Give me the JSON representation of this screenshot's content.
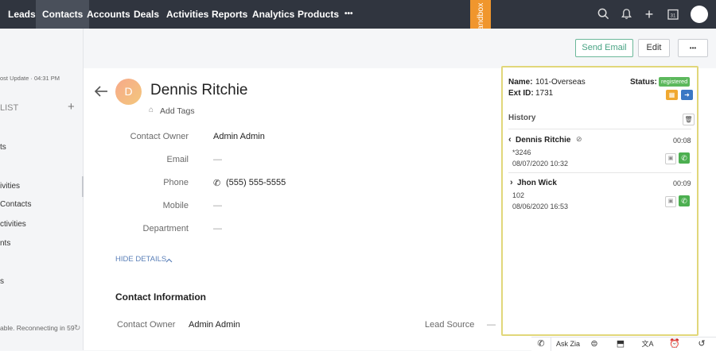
{
  "nav": {
    "items": [
      "Leads",
      "Contacts",
      "Accounts",
      "Deals",
      "Activities",
      "Reports",
      "Analytics",
      "Products"
    ],
    "more": "•••",
    "sandbox": "Sandbox"
  },
  "sidebar": {
    "last_update": "ost Update · 04:31 PM",
    "list_header": "LIST",
    "add": "+",
    "items": [
      "ts",
      "ivities",
      "Contacts",
      "ctivities",
      "nts",
      "s"
    ],
    "status": "able. Reconnecting in 59"
  },
  "toolbar": {
    "send_email": "Send Email",
    "edit": "Edit",
    "more": "•••"
  },
  "contact": {
    "avatar_letter": "D",
    "name": "Dennis Ritchie",
    "add_tags": "Add Tags",
    "fields": [
      {
        "label": "Contact Owner",
        "value": "Admin Admin"
      },
      {
        "label": "Email",
        "value": "—"
      },
      {
        "label": "Phone",
        "value": "(555) 555-5555"
      },
      {
        "label": "Mobile",
        "value": "—"
      },
      {
        "label": "Department",
        "value": "—"
      }
    ],
    "hide_details": "HIDE DETAILS"
  },
  "contact_info": {
    "title": "Contact Information",
    "owner_label": "Contact Owner",
    "owner_value": "Admin Admin",
    "lead_source_label": "Lead Source",
    "lead_source_value": "—"
  },
  "phone_panel": {
    "name_label": "Name:",
    "name_value": "101-Overseas",
    "ext_label": "Ext ID:",
    "ext_value": "1731",
    "status_label": "Status:",
    "status_value": "registered",
    "history_title": "History",
    "history": [
      {
        "name": "Dennis Ritchie",
        "number": "*3246",
        "date": "08/07/2020 10:32",
        "duration": "00:08",
        "direction": "incoming"
      },
      {
        "name": "Jhon Wick",
        "number": "102",
        "date": "08/06/2020 16:53",
        "duration": "00:09",
        "direction": "outgoing"
      }
    ],
    "colors": {
      "status": "#5cb85c",
      "call": "#4caf50",
      "border": "#e1d77a"
    }
  },
  "footer": {
    "ask_zia": "Ask Zia"
  }
}
